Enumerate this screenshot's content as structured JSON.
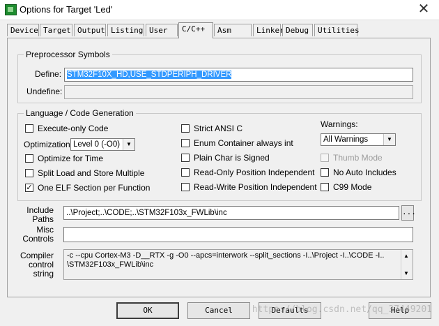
{
  "window": {
    "title": "Options for Target 'Led'"
  },
  "tabs": [
    {
      "label": "Device"
    },
    {
      "label": "Target"
    },
    {
      "label": "Output"
    },
    {
      "label": "Listing"
    },
    {
      "label": "User"
    },
    {
      "label": "C/C++"
    },
    {
      "label": "Asm"
    },
    {
      "label": "Linker"
    },
    {
      "label": "Debug"
    },
    {
      "label": "Utilities"
    }
  ],
  "active_tab": "C/C++",
  "preprocessor": {
    "legend": "Preprocessor Symbols",
    "define_label": "Define:",
    "define_value": "STM32F10X_HD,USE_STDPERIPH_DRIVER",
    "undefine_label": "Undefine:",
    "undefine_value": ""
  },
  "language": {
    "legend": "Language / Code Generation",
    "execute_only": {
      "label": "Execute-only Code",
      "checked": false
    },
    "optimization_label": "Optimization:",
    "optimization_value": "Level 0 (-O0)",
    "optimize_time": {
      "label": "Optimize for Time",
      "checked": false
    },
    "split_load": {
      "label": "Split Load and Store Multiple",
      "checked": false
    },
    "one_elf": {
      "label": "One ELF Section per Function",
      "checked": true
    },
    "strict_ansi": {
      "label": "Strict ANSI C",
      "checked": false
    },
    "enum_container": {
      "label": "Enum Container always int",
      "checked": false
    },
    "plain_char": {
      "label": "Plain Char is Signed",
      "checked": false
    },
    "ro_pos_indep": {
      "label": "Read-Only Position Independent",
      "checked": false
    },
    "rw_pos_indep": {
      "label": "Read-Write Position Independent",
      "checked": false
    },
    "warnings_label": "Warnings:",
    "warnings_value": "All Warnings",
    "thumb_mode": {
      "label": "Thumb Mode",
      "checked": false,
      "disabled": true
    },
    "no_auto_includes": {
      "label": "No Auto Includes",
      "checked": false
    },
    "c99_mode": {
      "label": "C99 Mode",
      "checked": false
    }
  },
  "include_paths": {
    "label_line1": "Include",
    "label_line2": "Paths",
    "value": "..\\Project;..\\CODE;..\\STM32F103x_FWLib\\inc",
    "browse_label": "..."
  },
  "misc_controls": {
    "label_line1": "Misc",
    "label_line2": "Controls",
    "value": ""
  },
  "compiler_control": {
    "label_line1": "Compiler",
    "label_line2": "control",
    "label_line3": "string",
    "line1": "-c --cpu Cortex-M3 -D__RTX -g -O0 --apcs=interwork --split_sections -I..\\Project -I..\\CODE -I..",
    "line2": "\\STM32F103x_FWLib\\inc"
  },
  "buttons": {
    "ok": "OK",
    "cancel": "Cancel",
    "defaults": "Defaults",
    "help": "Help"
  },
  "watermark": "https://blog.csdn.net/qq_37449201",
  "colors": {
    "selection": "#3399ff",
    "app_icon": "#1e8c2f"
  }
}
